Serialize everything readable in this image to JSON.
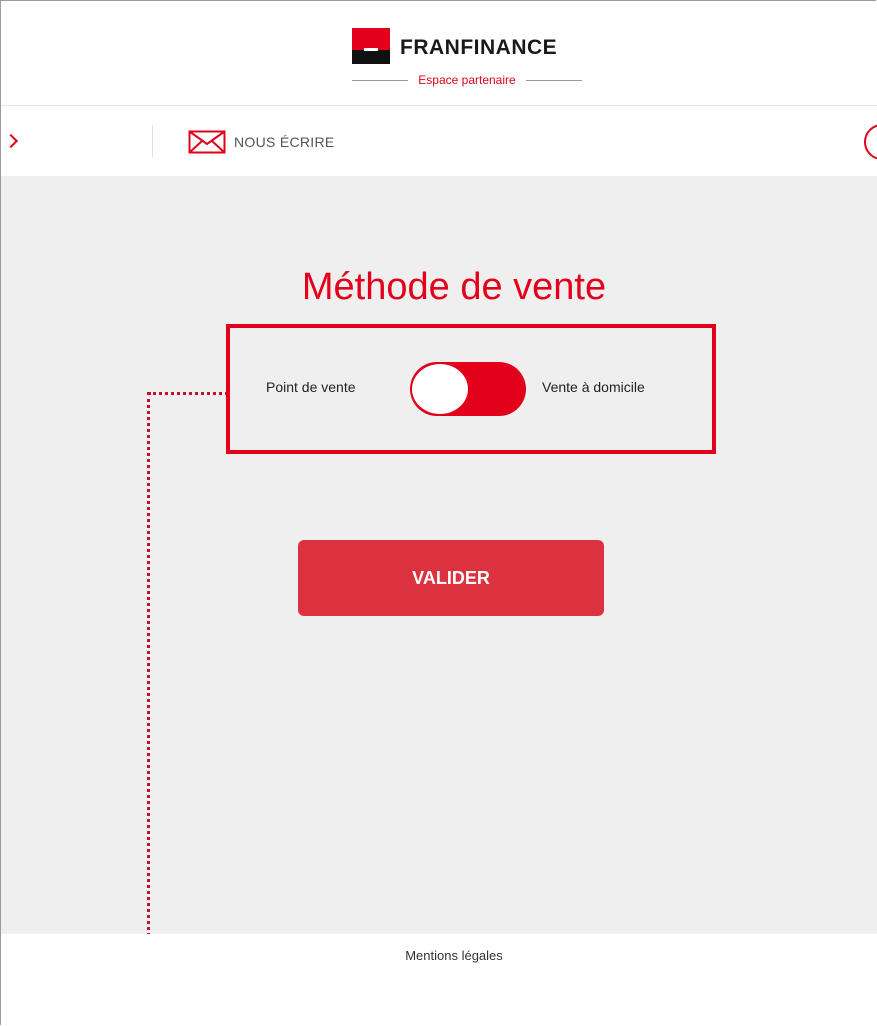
{
  "header": {
    "brand_name": "FRANFINANCE",
    "brand_subtitle": "Espace partenaire",
    "brand_colors": {
      "red": "#e2001a",
      "black": "#111111"
    }
  },
  "toolbar": {
    "contact_label": "NOUS ÉCRIRE",
    "contact_icon": "envelope-icon"
  },
  "main": {
    "title": "Méthode de vente",
    "toggle": {
      "left_label": "Point de vente",
      "right_label": "Vente à domicile",
      "selected": "Point de vente"
    },
    "submit_label": "VALIDER",
    "accent_color": "#e2001a",
    "button_color": "#dc323e",
    "background_color": "#efefef"
  },
  "footer": {
    "legal_link": "Mentions légales"
  }
}
